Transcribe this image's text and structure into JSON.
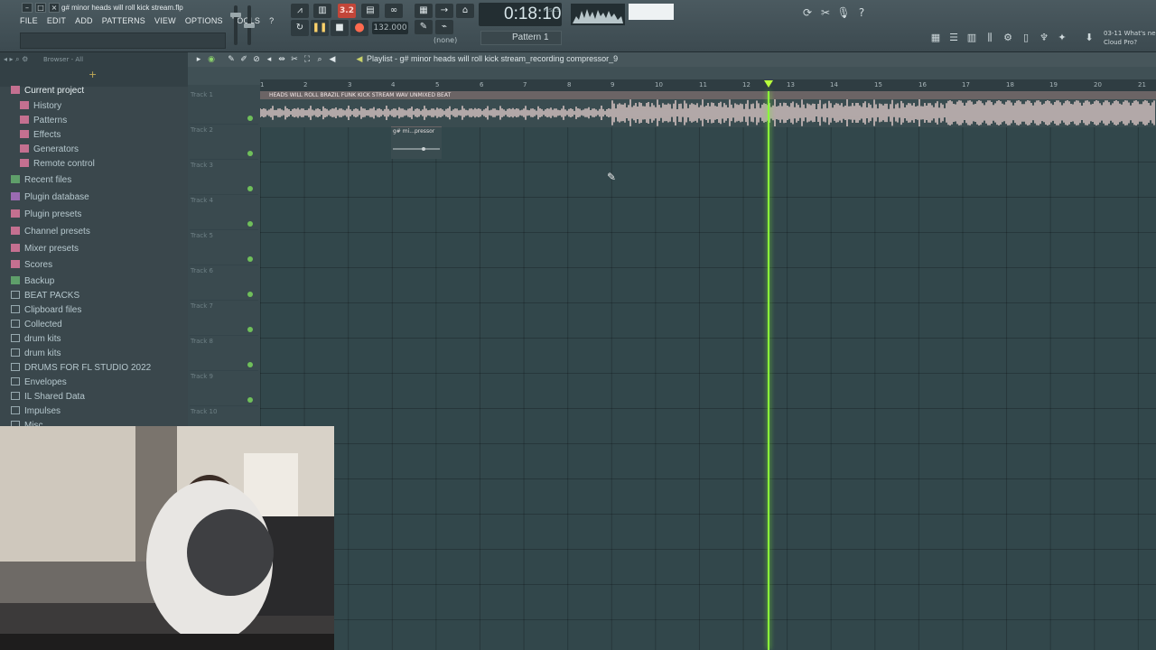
{
  "window": {
    "project_title": "g# minor heads will roll kick stream.flp",
    "menu": [
      "FILE",
      "EDIT",
      "ADD",
      "PATTERNS",
      "VIEW",
      "OPTIONS",
      "TOOLS",
      "?"
    ]
  },
  "transport": {
    "time": "0:18:10",
    "time_unit": "M:S:CS",
    "tempo": "132.000",
    "pattern": "Pattern 1",
    "snap": "(none)",
    "mode_badge": "3.2"
  },
  "news": {
    "line1": "03-11  What's ne",
    "line2": "Cloud Pro?"
  },
  "browser": {
    "title": "Browser - All",
    "items": [
      {
        "label": "Current project",
        "icon": "project-icon"
      },
      {
        "label": "History",
        "icon": "history-icon"
      },
      {
        "label": "Patterns",
        "icon": "patterns-icon"
      },
      {
        "label": "Effects",
        "icon": "effects-icon"
      },
      {
        "label": "Generators",
        "icon": "generators-icon"
      },
      {
        "label": "Remote control",
        "icon": "remote-icon"
      },
      {
        "label": "Recent files",
        "icon": "recent-icon"
      },
      {
        "label": "Plugin database",
        "icon": "plugin-db-icon"
      },
      {
        "label": "Plugin presets",
        "icon": "plugin-presets-icon"
      },
      {
        "label": "Channel presets",
        "icon": "channel-presets-icon"
      },
      {
        "label": "Mixer presets",
        "icon": "mixer-presets-icon"
      },
      {
        "label": "Scores",
        "icon": "scores-icon"
      },
      {
        "label": "Backup",
        "icon": "backup-icon"
      },
      {
        "label": "BEAT PACKS",
        "icon": "folder-icon"
      },
      {
        "label": "Clipboard files",
        "icon": "folder-icon"
      },
      {
        "label": "Collected",
        "icon": "folder-icon"
      },
      {
        "label": "drum kits",
        "icon": "folder-icon"
      },
      {
        "label": "drum kits",
        "icon": "folder-icon"
      },
      {
        "label": "DRUMS FOR FL STUDIO 2022",
        "icon": "folder-icon"
      },
      {
        "label": "Envelopes",
        "icon": "folder-icon"
      },
      {
        "label": "IL Shared Data",
        "icon": "folder-icon"
      },
      {
        "label": "Impulses",
        "icon": "folder-icon"
      },
      {
        "label": "Misc",
        "icon": "folder-icon"
      }
    ]
  },
  "playlist": {
    "title": "Playlist - g# minor heads will roll kick stream_recording compressor_9",
    "ruler": [
      "2",
      "3",
      "4",
      "5",
      "6",
      "7",
      "8",
      "9",
      "10",
      "11",
      "12",
      "13",
      "14",
      "15",
      "16",
      "17",
      "18",
      "19",
      "20",
      "21"
    ],
    "tracks": [
      "Track 1",
      "Track 2",
      "Track 3",
      "Track 4",
      "Track 5",
      "Track 6",
      "Track 7",
      "Track 8",
      "Track 9",
      "Track 10"
    ],
    "audio_clip_label": "HEADS WILL ROLL BRAZIL FUNK KICK STREAM WAV UNMIXED BEAT",
    "pattern_clip_label": "g# mi...pressor"
  }
}
